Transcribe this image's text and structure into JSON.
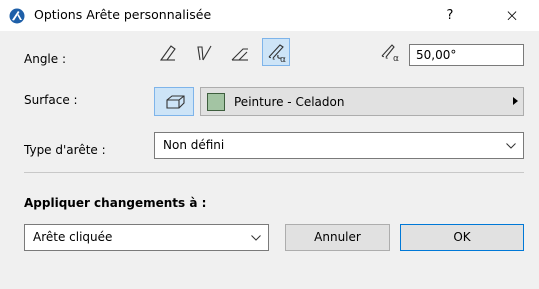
{
  "window": {
    "title": "Options Arête personnalisée",
    "help_label": "?",
    "close_label": "×"
  },
  "angle": {
    "label": "Angle :",
    "options": [
      "angle-1",
      "angle-2",
      "angle-3",
      "angle-custom"
    ],
    "selected_index": 3,
    "value": "50,00°"
  },
  "surface": {
    "label": "Surface :",
    "value": "Peinture - Celadon",
    "swatch_color": "#a3c4a3"
  },
  "edge_type": {
    "label": "Type d'arête :",
    "value": "Non défini"
  },
  "apply": {
    "label": "Appliquer changements à :",
    "value": "Arête cliquée"
  },
  "buttons": {
    "cancel": "Annuler",
    "ok": "OK"
  }
}
